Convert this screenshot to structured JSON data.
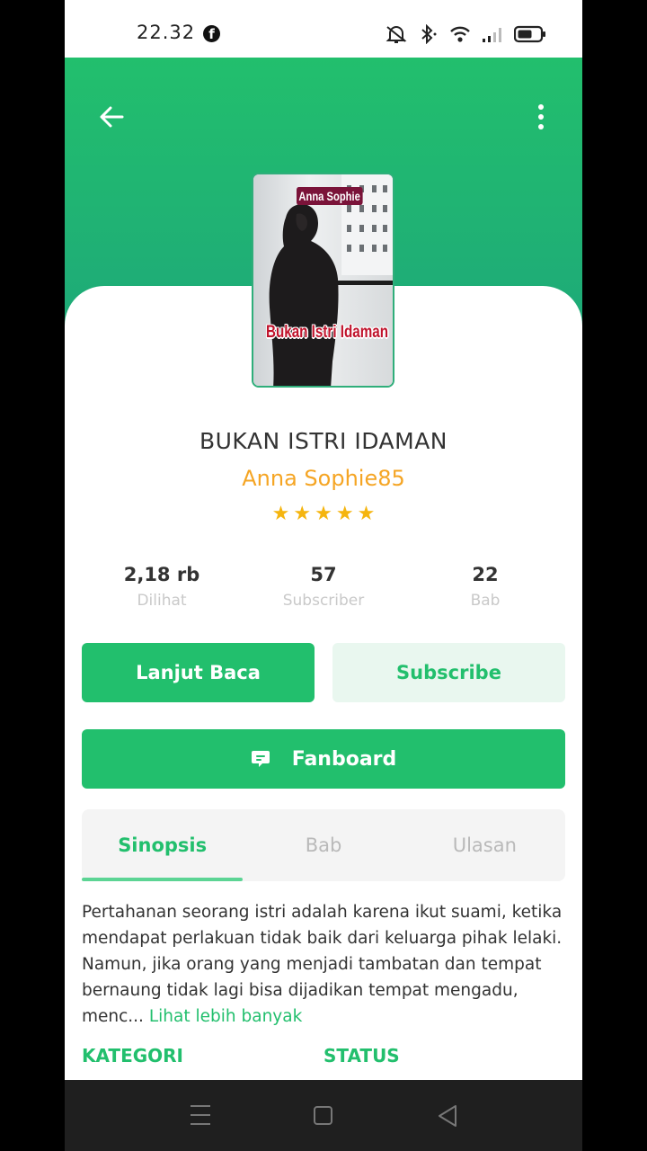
{
  "status_bar": {
    "time": "22.32",
    "app_icon": "facebook-icon",
    "icons": [
      "mute-icon",
      "bluetooth-icon",
      "wifi-icon",
      "signal-icon",
      "battery-icon"
    ]
  },
  "header": {
    "back_icon": "arrow-left-icon",
    "more_icon": "more-vertical-icon"
  },
  "cover": {
    "author_text": "Anna Sophie",
    "title_text": "Bukan Istri Idaman"
  },
  "book": {
    "title": "BUKAN ISTRI IDAMAN",
    "author": "Anna Sophie85",
    "rating": 5,
    "stars": [
      "★",
      "★",
      "★",
      "★",
      "★"
    ]
  },
  "stats": [
    {
      "value": "2,18 rb",
      "label": "Dilihat"
    },
    {
      "value": "57",
      "label": "Subscriber"
    },
    {
      "value": "22",
      "label": "Bab"
    }
  ],
  "actions": {
    "read_label": "Lanjut Baca",
    "subscribe_label": "Subscribe",
    "fanboard_label": "Fanboard",
    "fanboard_icon": "chat-bubble-icon"
  },
  "tabs": [
    {
      "label": "Sinopsis",
      "active": true
    },
    {
      "label": "Bab",
      "active": false
    },
    {
      "label": "Ulasan",
      "active": false
    }
  ],
  "synopsis": {
    "text": "Pertahanan seorang istri adalah karena ikut suami, ketika mendapat perlakuan tidak baik dari keluarga pihak lelaki. Namun, jika orang yang menjadi tambatan dan tempat bernaung tidak lagi bisa dijadikan tempat mengadu, menc...",
    "more_label": "Lihat lebih banyak"
  },
  "meta": {
    "category_label": "KATEGORI",
    "status_label": "STATUS"
  },
  "nav": {
    "icons": [
      "menu-icon",
      "home-icon",
      "back-triangle-icon"
    ]
  },
  "colors": {
    "primary": "#22bf6d",
    "author": "#f5a524",
    "star": "#f5b50f",
    "subscribe_bg": "#e9f7ef"
  }
}
